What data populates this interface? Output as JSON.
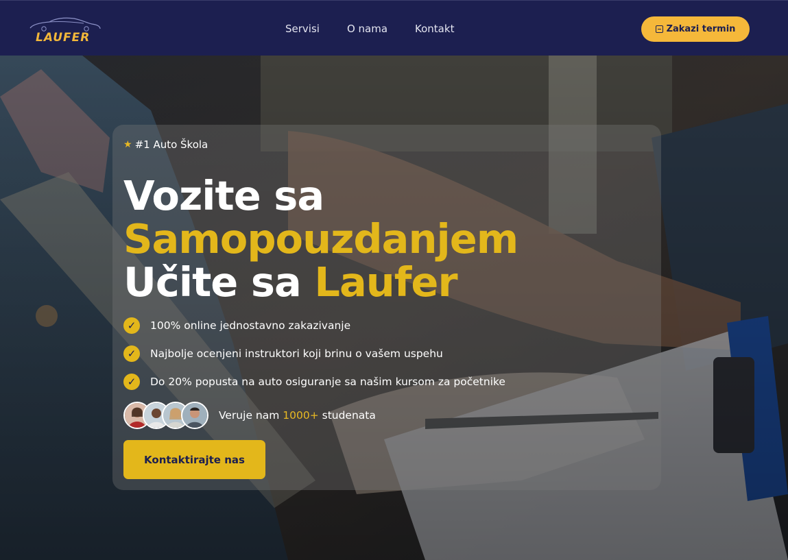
{
  "brand": {
    "name": "LAUFER",
    "accent": "#f2b73a",
    "header_bg": "#1c1f50"
  },
  "nav": {
    "items": [
      {
        "label": "Servisi"
      },
      {
        "label": "O nama"
      },
      {
        "label": "Kontakt"
      }
    ],
    "book_button": {
      "label": "Zakazi termin",
      "icon": "calendar-icon"
    }
  },
  "hero": {
    "badge": {
      "icon": "star-icon",
      "text": "#1 Auto Škola"
    },
    "headline": {
      "line1": "Vozite sa",
      "line2": "Samopouzdanjem",
      "line3_part1": "Učite sa ",
      "line3_part2": "Laufer"
    },
    "features": [
      {
        "icon": "check-icon",
        "text": "100% online jednostavno zakazivanje"
      },
      {
        "icon": "check-icon",
        "text": "Najbolje ocenjeni instruktori koji brinu o vašem uspehu"
      },
      {
        "icon": "check-icon",
        "text": "Do 20% popusta na auto osiguranje sa našim kursom za početnike"
      }
    ],
    "trust": {
      "prefix": "Veruje nam ",
      "count": "1000+",
      "suffix": " studenata"
    },
    "cta_label": "Kontaktirajte nas",
    "highlight_color": "#e3b71b"
  }
}
